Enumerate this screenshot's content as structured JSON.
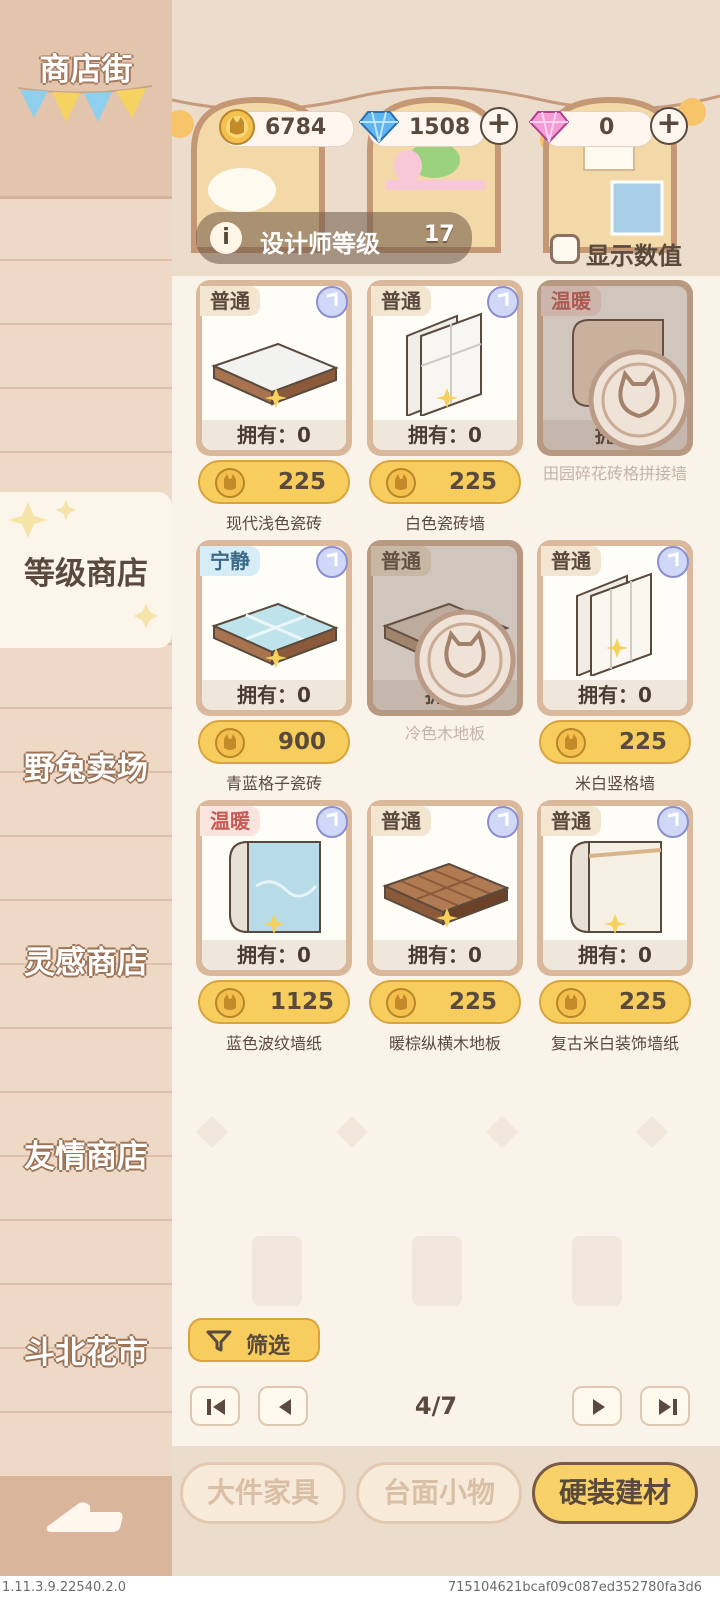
{
  "sidebar": {
    "header_title": "商店街",
    "items": [
      {
        "label": "等级商店"
      },
      {
        "label": "野兔卖场"
      },
      {
        "label": "灵感商店"
      },
      {
        "label": "友情商店"
      },
      {
        "label": "斗北花市"
      }
    ],
    "active_index": 0
  },
  "currencies": {
    "gold": "6784",
    "diamond": "1508",
    "pink_gem": "0"
  },
  "designer": {
    "label": "设计师等级",
    "level": "17"
  },
  "show_values": {
    "label": "显示数值",
    "checked": false
  },
  "products": [
    {
      "tag": "普通",
      "owned": "拥有：0",
      "price": "225",
      "name": "现代浅色瓷砖",
      "locked": false
    },
    {
      "tag": "普通",
      "owned": "拥有：0",
      "price": "225",
      "name": "白色瓷砖墙",
      "locked": false
    },
    {
      "tag": "温暖",
      "owned": "拥有",
      "price": "",
      "name": "田园碎花砖格拼接墙",
      "locked": true
    },
    {
      "tag": "宁静",
      "owned": "拥有：0",
      "price": "900",
      "name": "青蓝格子瓷砖",
      "locked": false
    },
    {
      "tag": "普通",
      "owned": "拥有",
      "price": "",
      "name": "冷色木地板",
      "locked": true
    },
    {
      "tag": "普通",
      "owned": "拥有：0",
      "price": "225",
      "name": "米白竖格墙",
      "locked": false
    },
    {
      "tag": "温暖",
      "owned": "拥有：0",
      "price": "1125",
      "name": "蓝色波纹墙纸",
      "locked": false
    },
    {
      "tag": "普通",
      "owned": "拥有：0",
      "price": "225",
      "name": "暖棕纵横木地板",
      "locked": false
    },
    {
      "tag": "普通",
      "owned": "拥有：0",
      "price": "225",
      "name": "复古米白装饰墙纸",
      "locked": false
    }
  ],
  "filter": {
    "label": "筛选"
  },
  "pagination": {
    "indicator": "4/7"
  },
  "tabs": [
    {
      "label": "大件家具"
    },
    {
      "label": "台面小物"
    },
    {
      "label": "硬装建材"
    }
  ],
  "active_tab": 2,
  "footer": {
    "version": "1.11.3.9.22540.2.0",
    "build_hash": "715104621bcaf09c087ed352780fa3d6"
  },
  "colors": {
    "accent_gold": "#f7cd5e",
    "text_dark": "#5a4a3e",
    "warm_tag": "#c45b54",
    "calm_tag": "#3b6b88"
  }
}
